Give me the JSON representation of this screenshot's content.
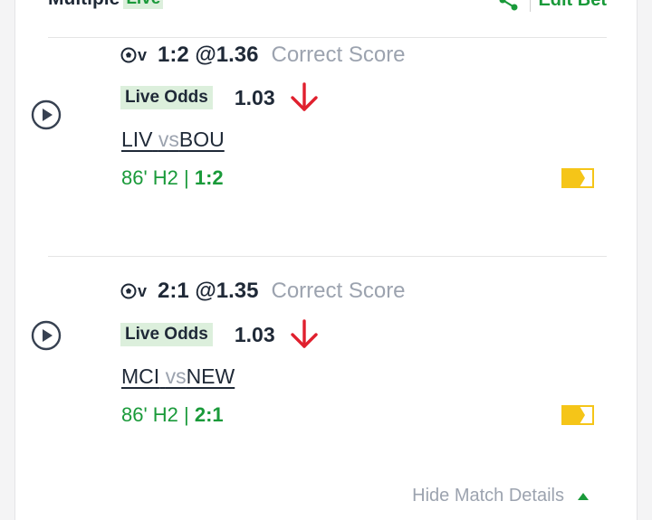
{
  "header": {
    "title": "Multiple",
    "live_badge": "Live",
    "edit_bet_label": "Edit Bet",
    "share_icon": "share-icon"
  },
  "bets": [
    {
      "sport_icon_label": "v",
      "selection": "1:2 @1.36",
      "market": "Correct Score",
      "odds_badge": "Live Odds",
      "live_odds": "1.03",
      "odds_trend": "down",
      "home": "LIV",
      "vs": "vs",
      "away": "BOU",
      "time": "86' H2 |",
      "score": "1:2"
    },
    {
      "sport_icon_label": "v",
      "selection": "2:1 @1.35",
      "market": "Correct Score",
      "odds_badge": "Live Odds",
      "live_odds": "1.03",
      "odds_trend": "down",
      "home": "MCI",
      "vs": "vs",
      "away": "NEW",
      "time": "86' H2 |",
      "score": "2:1"
    }
  ],
  "footer": {
    "hide_details_label": "Hide Match Details"
  },
  "colors": {
    "accent_green": "#1a9a3a",
    "badge_bg": "#dcefdc",
    "down_arrow": "#e0202e",
    "tag_yellow": "#f5c518"
  }
}
